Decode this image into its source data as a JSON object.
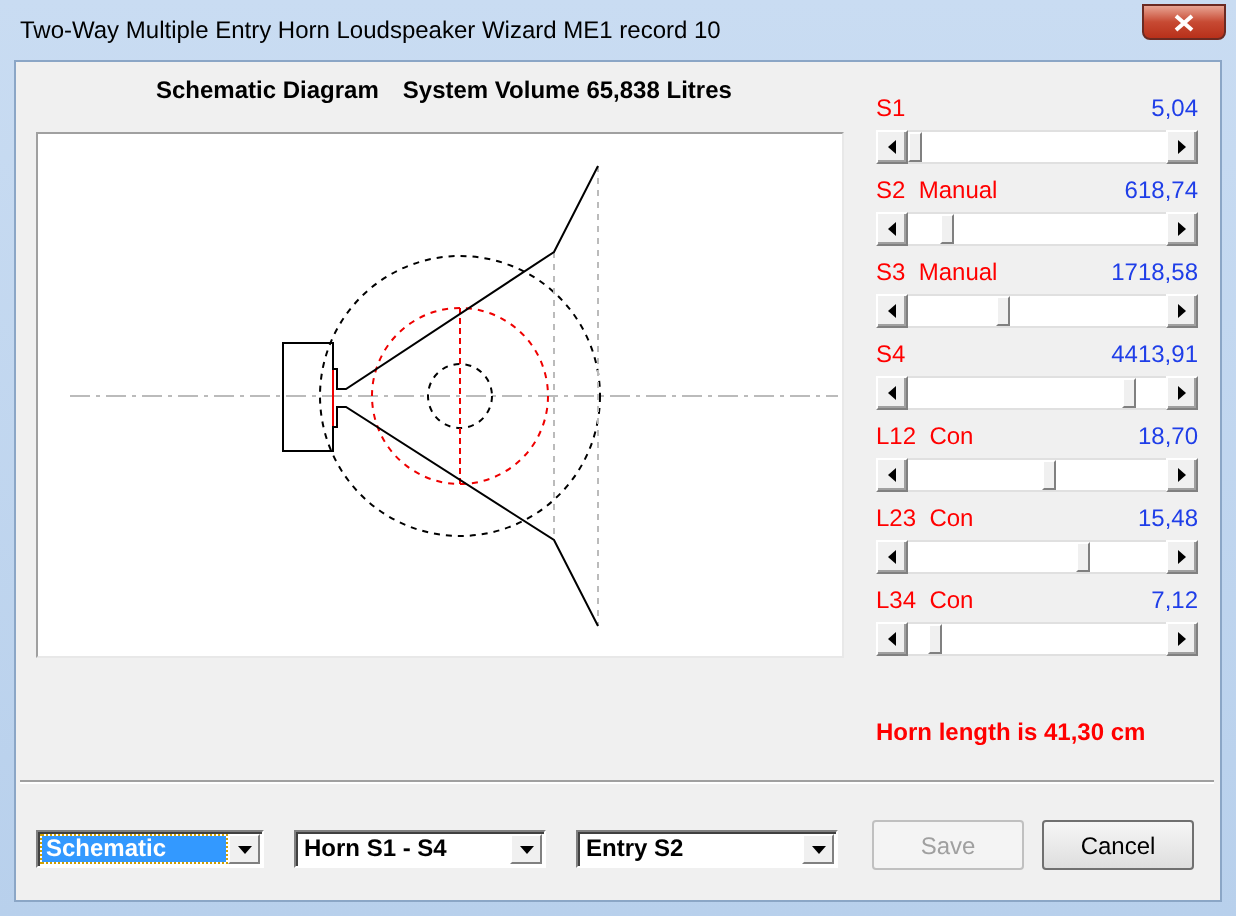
{
  "window": {
    "title": "Two-Way Multiple Entry Horn Loudspeaker Wizard   ME1 record 10"
  },
  "diagram": {
    "heading": "Schematic Diagram",
    "volume": "System Volume 65,838 Litres"
  },
  "parameters": [
    {
      "name": "S1",
      "value": "5,04",
      "level": 0
    },
    {
      "name": "S2",
      "mode": "Manual",
      "value": "618,74",
      "level": 0.13
    },
    {
      "name": "S3",
      "mode": "Manual",
      "value": "1718,58",
      "level": 0.36
    },
    {
      "name": "S4",
      "value": "4413,91",
      "level": 0.88
    },
    {
      "name": "L12",
      "mode": "Con",
      "value": "18,70",
      "level": 0.55
    },
    {
      "name": "L23",
      "mode": "Con",
      "value": "15,48",
      "level": 0.69
    },
    {
      "name": "L34",
      "mode": "Con",
      "value": "7,12",
      "level": 0.08
    }
  ],
  "horn_length": "Horn length is 41,30 cm",
  "dropdowns": [
    {
      "value": "Schematic",
      "focused": true
    },
    {
      "value": "Horn S1 - S4",
      "focused": false
    },
    {
      "value": "Entry S2",
      "focused": false
    }
  ],
  "buttons": [
    {
      "label": "Save",
      "disabled": true
    },
    {
      "label": "Cancel",
      "disabled": false
    }
  ]
}
